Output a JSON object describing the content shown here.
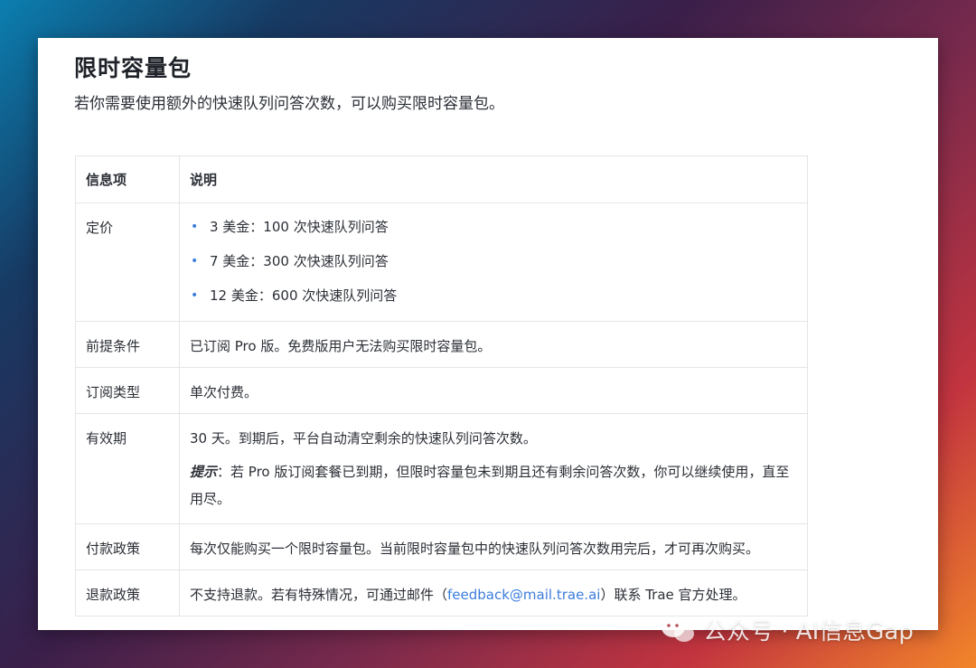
{
  "title": "限时容量包",
  "intro": "若你需要使用额外的快速队列问答次数，可以购买限时容量包。",
  "table": {
    "headers": [
      "信息项",
      "说明"
    ],
    "rows": {
      "pricing": {
        "label": "定价",
        "items": [
          "3 美金：100 次快速队列问答",
          "7 美金：300 次快速队列问答",
          "12 美金：600 次快速队列问答"
        ]
      },
      "prerequisite": {
        "label": "前提条件",
        "text": "已订阅 Pro 版。免费版用户无法购买限时容量包。"
      },
      "type": {
        "label": "订阅类型",
        "text": "单次付费。"
      },
      "validity": {
        "label": "有效期",
        "text": "30 天。到期后，平台自动清空剩余的快速队列问答次数。",
        "tip_label": "提示",
        "tip_text": "：若 Pro 版订阅套餐已到期，但限时容量包未到期且还有剩余问答次数，你可以继续使用，直至用尽。"
      },
      "payment": {
        "label": "付款政策",
        "text": "每次仅能购买一个限时容量包。当前限时容量包中的快速队列问答次数用完后，才可再次购买。"
      },
      "refund": {
        "label": "退款政策",
        "text_before": "不支持退款。若有特殊情况，可通过邮件（",
        "email": "feedback@mail.trae.ai",
        "text_after": "）联系 Trae 官方处理。"
      }
    }
  },
  "watermark": "公众号 · AI信息Gap",
  "colors": {
    "link": "#3b7ddd",
    "bullet": "#3b7ddd",
    "border": "#e3e5e8",
    "text": "#2b2f36"
  }
}
